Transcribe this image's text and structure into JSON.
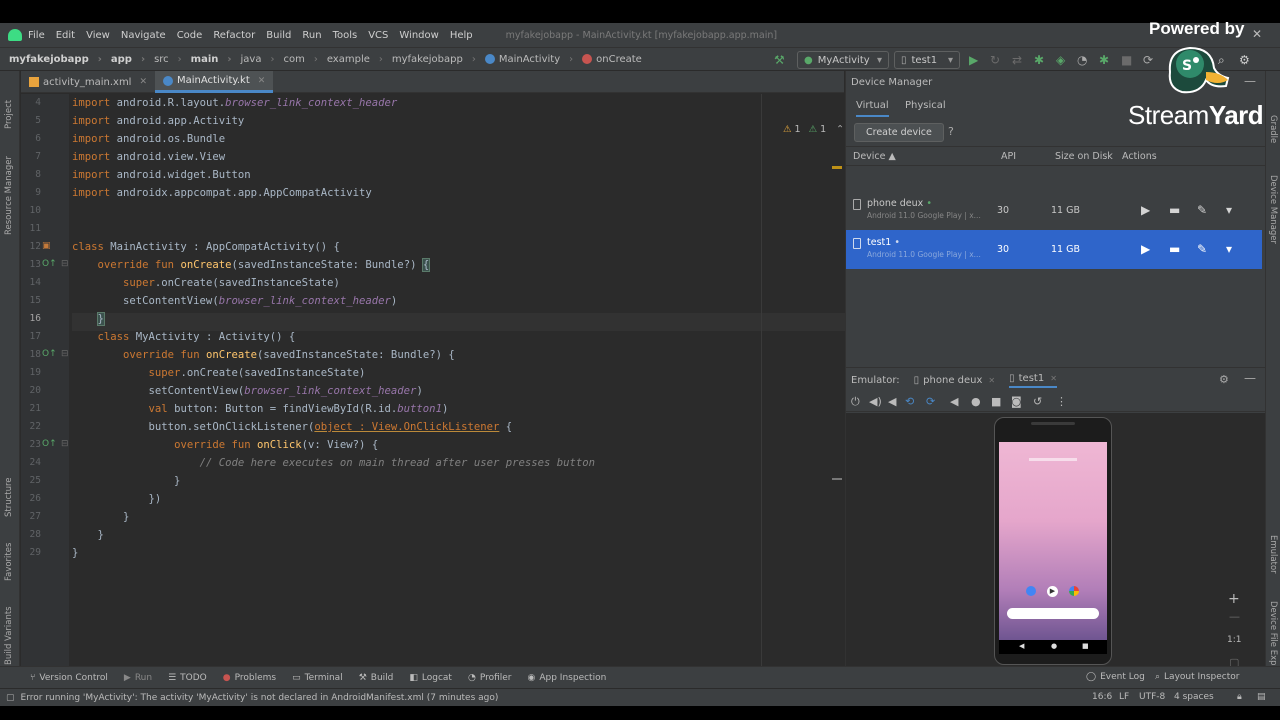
{
  "menubar": {
    "items": [
      "File",
      "Edit",
      "View",
      "Navigate",
      "Code",
      "Refactor",
      "Build",
      "Run",
      "Tools",
      "VCS",
      "Window",
      "Help"
    ],
    "window_title": "myfakejobapp - MainActivity.kt [myfakejobapp.app.main]"
  },
  "breadcrumbs": [
    "myfakejobapp",
    "app",
    "src",
    "main",
    "java",
    "com",
    "example",
    "myfakejobapp",
    "MainActivity",
    "onCreate"
  ],
  "toolbar": {
    "run_config": "MyActivity",
    "device": "test1"
  },
  "editor": {
    "tabs": [
      {
        "label": "activity_main.xml",
        "active": false
      },
      {
        "label": "MainActivity.kt",
        "active": true
      }
    ],
    "inspection": {
      "warnings": "1",
      "weak_warnings": "1"
    },
    "line_numbers": [
      "4",
      "5",
      "6",
      "7",
      "8",
      "9",
      "10",
      "11",
      "12",
      "13",
      "14",
      "15",
      "16",
      "17",
      "18",
      "19",
      "20",
      "21",
      "22",
      "23",
      "24",
      "25",
      "26",
      "27",
      "28",
      "29"
    ],
    "current_line": "16"
  },
  "left_strip": [
    "Project",
    "Resource Manager",
    "Structure",
    "Favorites",
    "Build Variants"
  ],
  "right_strip": [
    "Gradle",
    "Device Manager",
    "Emulator",
    "Device File Explorer"
  ],
  "device_manager": {
    "title": "Device Manager",
    "tabs": [
      "Virtual",
      "Physical"
    ],
    "create_label": "Create device",
    "help_label": "?",
    "columns": [
      "Device",
      "API",
      "Size on Disk",
      "Actions"
    ],
    "devices": [
      {
        "name": "phone deux",
        "subtitle": "Android 11.0 Google Play | x...",
        "api": "30",
        "size": "11 GB"
      },
      {
        "name": "test1",
        "subtitle": "Android 11.0 Google Play | x...",
        "api": "30",
        "size": "11 GB"
      }
    ]
  },
  "emulator": {
    "label": "Emulator:",
    "tabs": [
      "phone deux",
      "test1"
    ],
    "zoom_label": "1:1"
  },
  "bottom_tools": [
    "Version Control",
    "Run",
    "TODO",
    "Problems",
    "Terminal",
    "Build",
    "Logcat",
    "Profiler",
    "App Inspection"
  ],
  "bottom_right_tools": [
    "Event Log",
    "Layout Inspector"
  ],
  "status": {
    "message": "Error running 'MyActivity': The activity 'MyActivity' is not declared in AndroidManifest.xml (7 minutes ago)",
    "position": "16:6",
    "line_sep": "LF",
    "encoding": "UTF-8",
    "indent": "4 spaces"
  },
  "overlay": {
    "powered_by": "Powered by",
    "brand_a": "Stream",
    "brand_b": "Yard"
  }
}
